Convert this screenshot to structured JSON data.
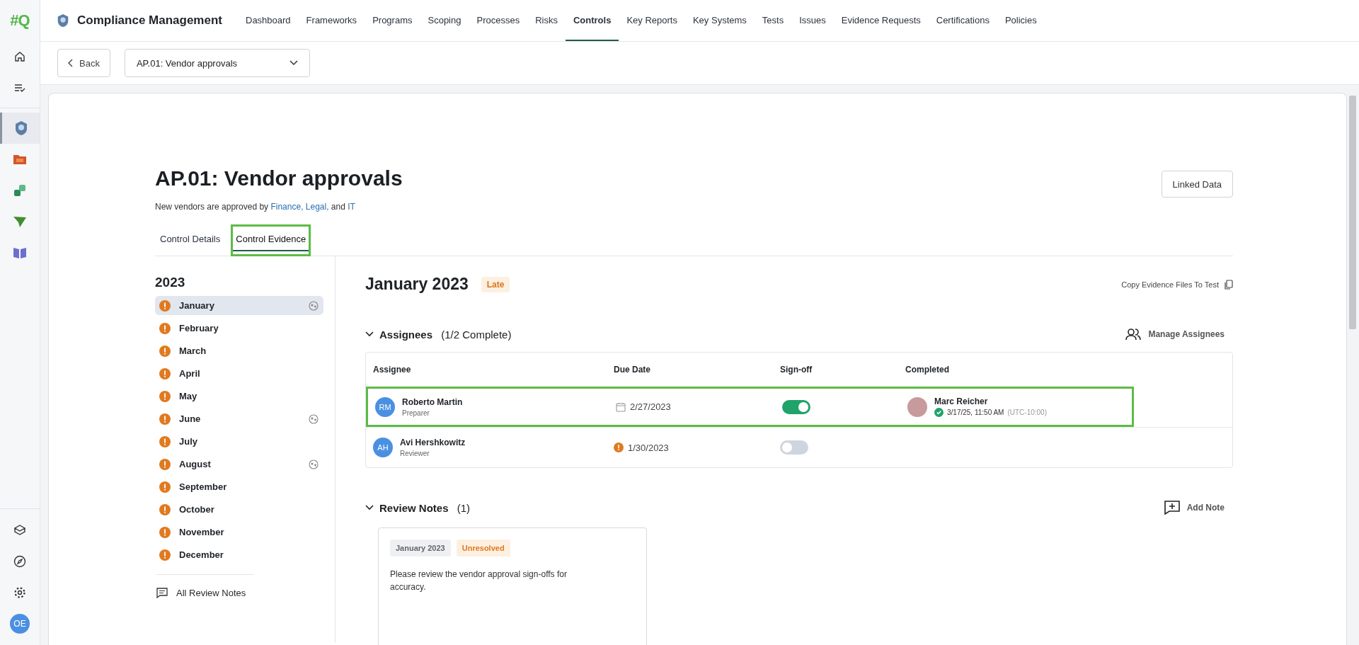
{
  "app": {
    "logo": "#Q",
    "title": "Compliance Management",
    "user_initials": "OE"
  },
  "nav": [
    {
      "label": "Dashboard",
      "selected": false
    },
    {
      "label": "Frameworks",
      "selected": false
    },
    {
      "label": "Programs",
      "selected": false
    },
    {
      "label": "Scoping",
      "selected": false
    },
    {
      "label": "Processes",
      "selected": false
    },
    {
      "label": "Risks",
      "selected": false
    },
    {
      "label": "Controls",
      "selected": true
    },
    {
      "label": "Key Reports",
      "selected": false
    },
    {
      "label": "Key Systems",
      "selected": false
    },
    {
      "label": "Tests",
      "selected": false
    },
    {
      "label": "Issues",
      "selected": false
    },
    {
      "label": "Evidence Requests",
      "selected": false
    },
    {
      "label": "Certifications",
      "selected": false
    },
    {
      "label": "Policies",
      "selected": false
    }
  ],
  "rail": [
    {
      "kind": "home",
      "selected": false
    },
    {
      "kind": "list",
      "selected": false
    },
    {
      "kind": "badge",
      "selected": true
    },
    {
      "kind": "folder",
      "selected": false
    },
    {
      "kind": "sync",
      "selected": false
    },
    {
      "kind": "plane",
      "selected": false
    },
    {
      "kind": "book",
      "selected": false
    }
  ],
  "rail_bottom": [
    {
      "kind": "cube"
    },
    {
      "kind": "compass"
    },
    {
      "kind": "gear"
    }
  ],
  "toolbar": {
    "back": "Back",
    "control_select": "AP.01: Vendor approvals"
  },
  "control": {
    "title": "AP.01: Vendor approvals",
    "description": [
      {
        "kind": "text",
        "text": "New vendors are approved by"
      },
      {
        "kind": "link",
        "text": "Finance,"
      },
      {
        "kind": "link",
        "text": "Legal,"
      },
      {
        "kind": "text",
        "text": "and"
      },
      {
        "kind": "link",
        "text": "IT"
      }
    ],
    "linked_data": "Linked Data"
  },
  "tabs": [
    {
      "label": "Control Details",
      "selected": false,
      "highlighted": false
    },
    {
      "label": "Control Evidence",
      "selected": true,
      "highlighted": true
    }
  ],
  "year": "2023",
  "months": [
    {
      "label": "January",
      "selected": true,
      "late": true,
      "comments": true
    },
    {
      "label": "February",
      "selected": false,
      "late": true,
      "comments": false
    },
    {
      "label": "March",
      "selected": false,
      "late": true,
      "comments": false
    },
    {
      "label": "April",
      "selected": false,
      "late": true,
      "comments": false
    },
    {
      "label": "May",
      "selected": false,
      "late": true,
      "comments": false
    },
    {
      "label": "June",
      "selected": false,
      "late": true,
      "comments": true
    },
    {
      "label": "July",
      "selected": false,
      "late": true,
      "comments": false
    },
    {
      "label": "August",
      "selected": false,
      "late": true,
      "comments": true
    },
    {
      "label": "September",
      "selected": false,
      "late": true,
      "comments": false
    },
    {
      "label": "October",
      "selected": false,
      "late": true,
      "comments": false
    },
    {
      "label": "November",
      "selected": false,
      "late": true,
      "comments": false
    },
    {
      "label": "December",
      "selected": false,
      "late": true,
      "comments": false
    }
  ],
  "all_review_notes": "All Review Notes",
  "period": {
    "title": "January 2023",
    "status": "Late",
    "copy_action": "Copy Evidence Files To Test"
  },
  "assignees": {
    "heading": "Assignees",
    "count": "(1/2 Complete)",
    "expanded": true,
    "manage": "Manage Assignees",
    "columns": [
      "Assignee",
      "Due Date",
      "Sign-off",
      "Completed"
    ],
    "rows": [
      {
        "initials": "RM",
        "name": "Roberto Martin",
        "role": "Preparer",
        "due_late": false,
        "due_date": "2/27/2023",
        "signed_off": true,
        "highlighted": true,
        "completed": {
          "name": "Marc Reicher",
          "time": "3/17/25, 11:50 AM",
          "timezone": "(UTC-10:00)"
        }
      },
      {
        "initials": "AH",
        "name": "Avi Hershkowitz",
        "role": "Reviewer",
        "due_late": true,
        "due_date": "1/30/2023",
        "signed_off": false,
        "highlighted": false
      }
    ]
  },
  "review_notes": {
    "heading": "Review Notes",
    "count": "(1)",
    "expanded": true,
    "add": "Add Note",
    "notes": [
      {
        "period": "January 2023",
        "status": "Unresolved",
        "text": "Please review the vendor approval sign-offs for accuracy."
      }
    ]
  }
}
